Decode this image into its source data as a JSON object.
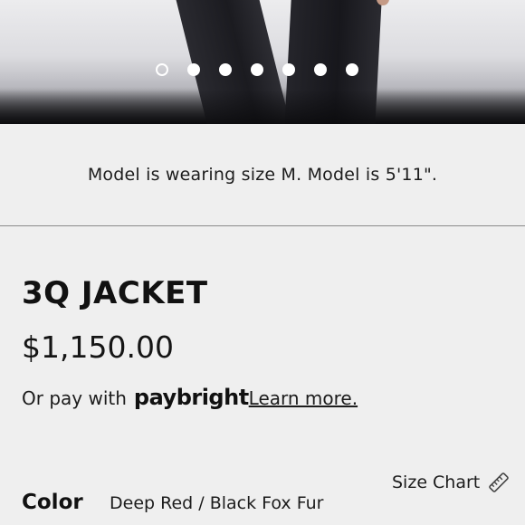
{
  "gallery": {
    "slide_count": 7,
    "active_index": 0
  },
  "model_info": "Model is wearing size M. Model is 5'11\".",
  "product": {
    "title": "3Q JACKET",
    "price": "$1,150.00"
  },
  "financing": {
    "prefix": "Or pay with",
    "brand": "paybright",
    "link": "Learn more."
  },
  "size_chart": {
    "label": "Size Chart",
    "icon": "ruler-icon"
  },
  "color": {
    "label": "Color",
    "value": "Deep Red / Black Fox Fur"
  }
}
